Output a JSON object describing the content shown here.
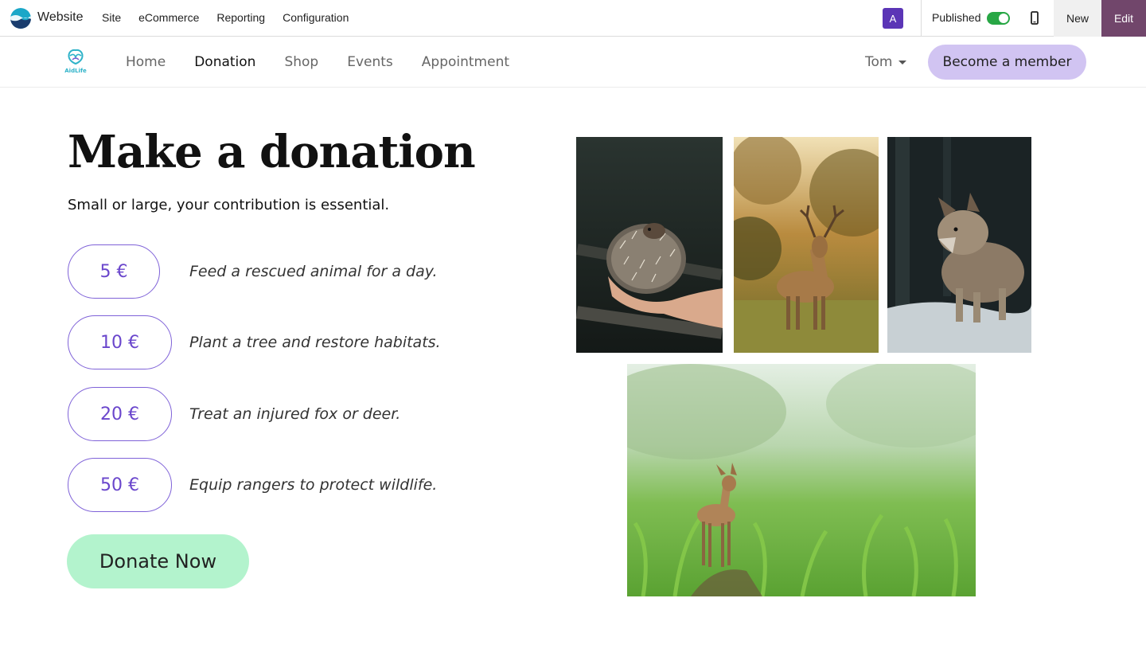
{
  "adminbar": {
    "app_name": "Website",
    "menu": [
      "Site",
      "eCommerce",
      "Reporting",
      "Configuration"
    ],
    "avatar_letter": "A",
    "published_label": "Published",
    "published": true,
    "new_label": "New",
    "edit_label": "Edit"
  },
  "sitenav": {
    "logo_text": "AidLife",
    "menu": [
      {
        "label": "Home",
        "active": false
      },
      {
        "label": "Donation",
        "active": true
      },
      {
        "label": "Shop",
        "active": false
      },
      {
        "label": "Events",
        "active": false
      },
      {
        "label": "Appointment",
        "active": false
      }
    ],
    "user_name": "Tom",
    "cta_label": "Become a member"
  },
  "main": {
    "title": "Make a donation",
    "subtitle": "Small or large, your contribution is essential.",
    "amounts": [
      {
        "amount": "5 €",
        "description": "Feed a rescued animal for a day."
      },
      {
        "amount": "10 €",
        "description": "Plant a tree and restore habitats."
      },
      {
        "amount": "20 €",
        "description": "Treat an injured fox or deer."
      },
      {
        "amount": "50 €",
        "description": "Equip rangers to protect wildlife."
      }
    ],
    "donate_label": "Donate Now"
  },
  "colors": {
    "accent_purple": "#7f62d8",
    "member_button": "#d1c4f2",
    "donate_button": "#b3f3cd",
    "edit_button": "#71466b",
    "toggle_on": "#28a745"
  },
  "images": [
    "hedgehog-photo",
    "deer-stag-photo",
    "wolf-photo",
    "fawn-in-field-photo"
  ]
}
